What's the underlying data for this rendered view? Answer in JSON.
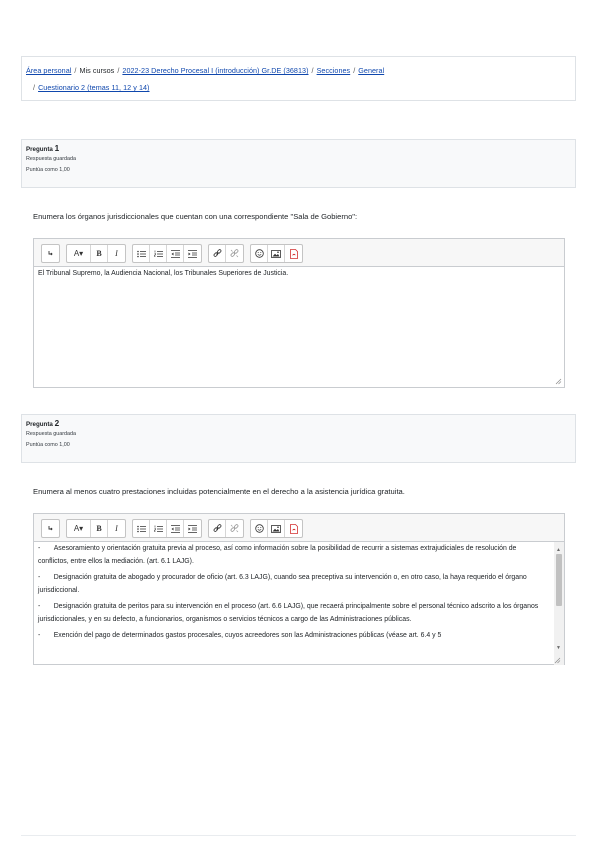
{
  "breadcrumb": {
    "items": [
      {
        "label": "Área personal",
        "link": true
      },
      {
        "label": "Mis cursos",
        "link": false
      },
      {
        "label": "2022-23 Derecho Procesal I (introducción) Gr.DE (36813)",
        "link": true
      },
      {
        "label": "Secciones",
        "link": true
      },
      {
        "label": "General",
        "link": true
      },
      {
        "label": "Cuestionario 2 (temas 11, 12 y 14)",
        "link": true
      }
    ],
    "separator": "/"
  },
  "questions": [
    {
      "label": "Pregunta",
      "number": "1",
      "status": "Respuesta guardada",
      "points": "Puntúa como 1,00",
      "text": "Enumera los órganos jurisdiccionales que cuentan con una correspondiente \"Sala de Gobierno\":",
      "answer": "El Tribunal Supremo, la Audiencia Nacional, los Tribunales Superiores de Justicia."
    },
    {
      "label": "Pregunta",
      "number": "2",
      "status": "Respuesta guardada",
      "points": "Puntúa como 1,00",
      "text": "Enumera al menos cuatro prestaciones incluidas potencialmente en el derecho a la asistencia jurídica gratuita.",
      "answer_paragraphs": [
        "-       Asesoramiento y orientación gratuita previa al proceso, así como información sobre la posibilidad de recurrir a sistemas extrajudiciales de resolución de conflictos, entre ellos la mediación. (art. 6.1 LAJG).",
        "-       Designación gratuita de abogado y procurador de oficio (art. 6.3 LAJG), cuando sea preceptiva su intervención o, en otro caso, la haya requerido el órgano jurisdiccional.",
        "-       Designación gratuita de peritos para su intervención en el proceso (art. 6.6 LAJG), que recaerá principalmente sobre el personal técnico adscrito a los órganos jurisdiccionales, y en su defecto, a funcionarios, organismos o servicios técnicos a cargo de las Administraciones públicas.",
        "-       Exención del pago de determinados gastos procesales, cuyos acreedores son las Administraciones públicas (véase art. 6.4 y 5"
      ]
    }
  ],
  "toolbar": {
    "buttons": [
      "collapse-icon",
      "font-style-icon",
      "bold-icon",
      "italic-icon",
      "unordered-list-icon",
      "ordered-list-icon",
      "outdent-icon",
      "indent-icon",
      "link-icon",
      "unlink-icon",
      "emoji-icon",
      "image-icon",
      "pdf-icon"
    ],
    "font_label": "A▾",
    "bold_label": "B",
    "italic_label": "I"
  }
}
